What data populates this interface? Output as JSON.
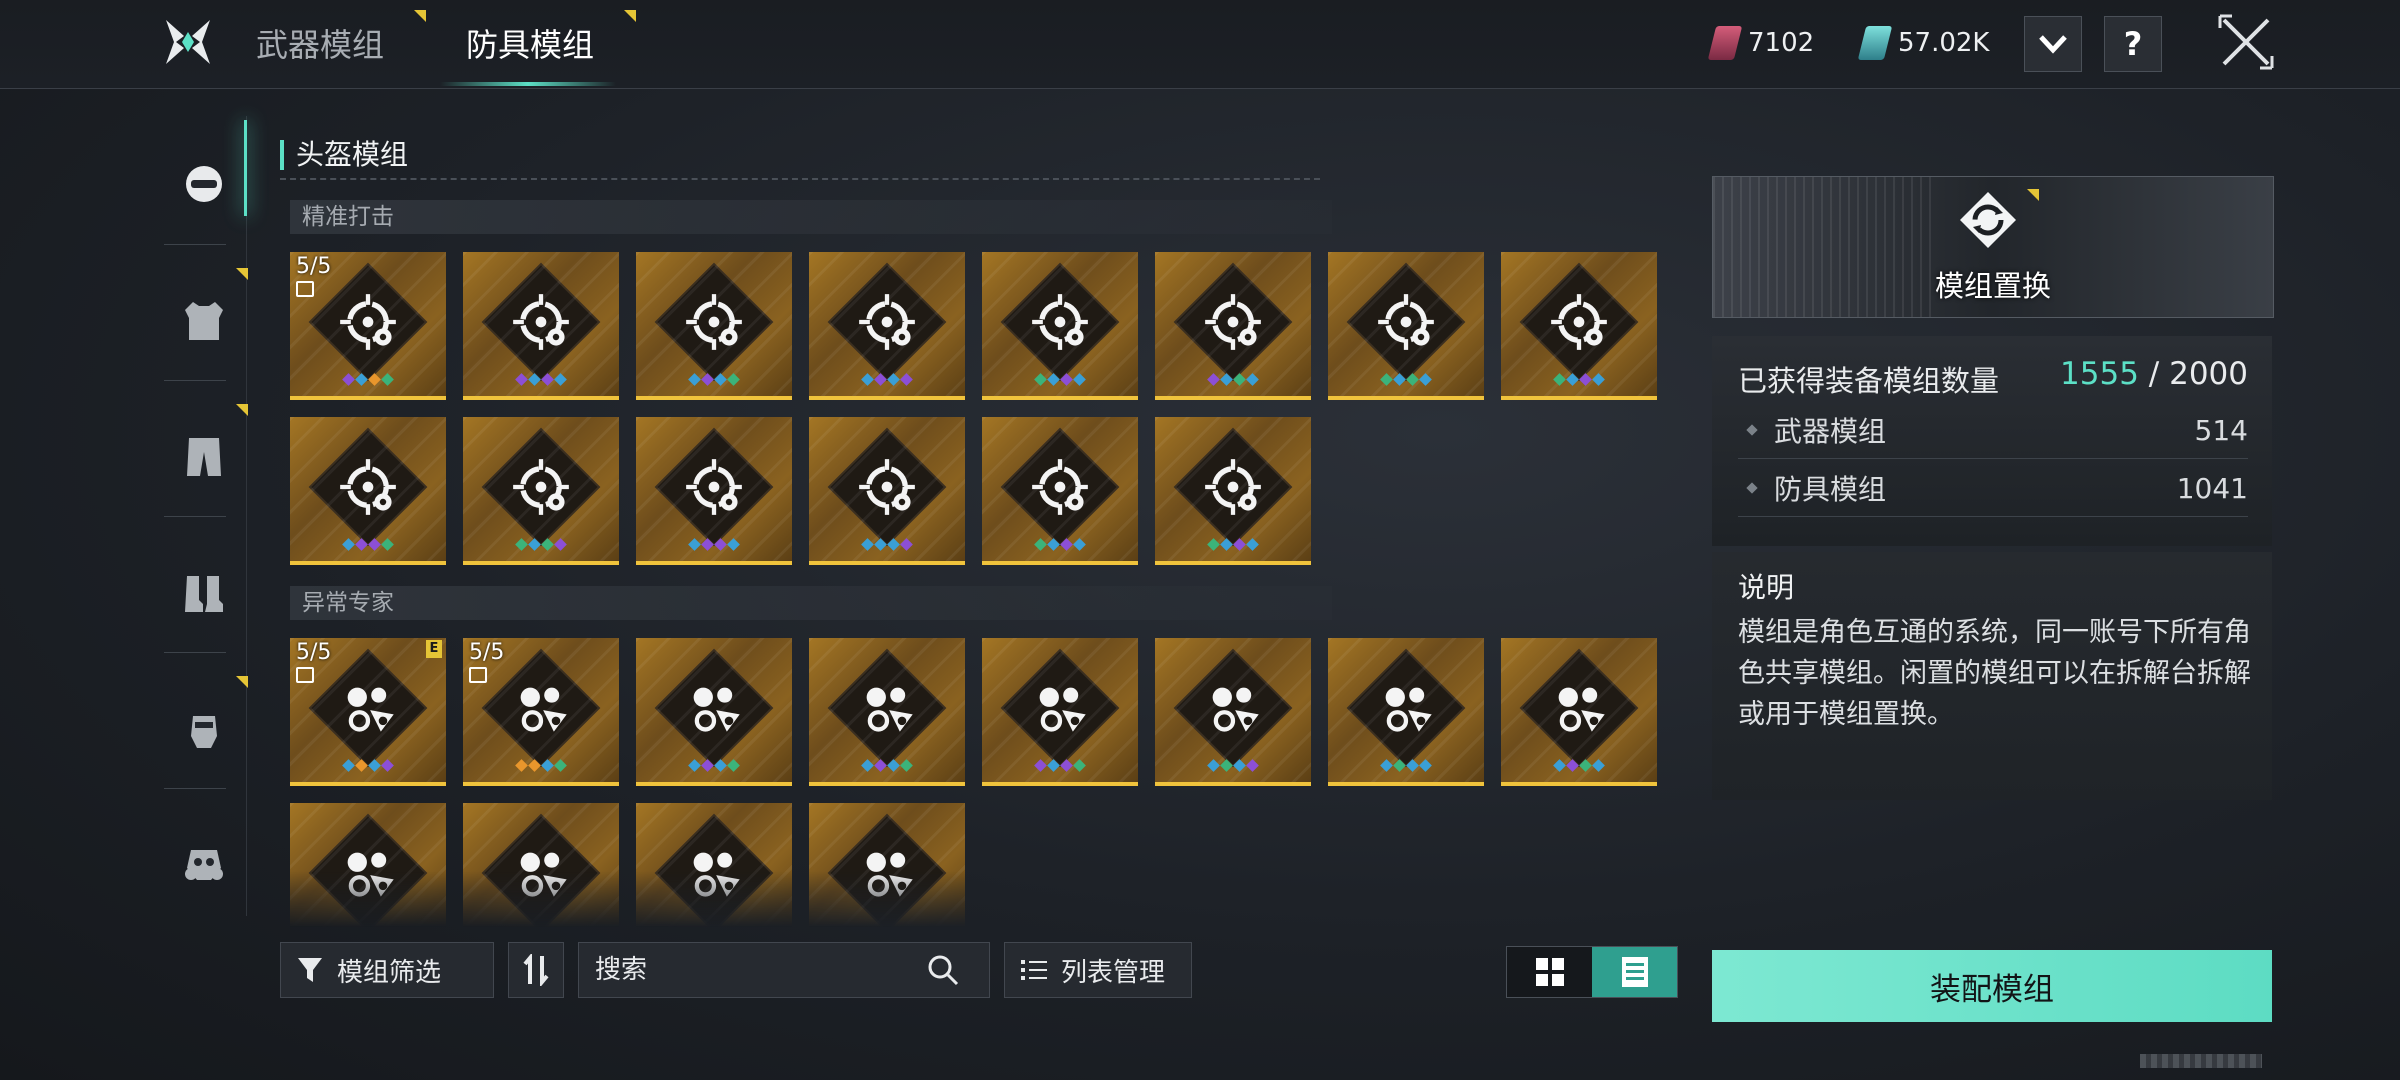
{
  "top_tabs": {
    "weapon": "武器模组",
    "armor": "防具模组"
  },
  "currency": {
    "red_amount": "7102",
    "teal_amount": "57.02K"
  },
  "help_label": "?",
  "section_title": "头盔模组",
  "groups": [
    {
      "name": "精准打击",
      "emblem": "crosshair-gear-icon"
    },
    {
      "name": "异常专家",
      "emblem": "anomaly-gear-icon"
    }
  ],
  "card_lock": {
    "count": "5/5"
  },
  "badge_e": "E",
  "gem_colors": {
    "orange": "#e8962c",
    "blue": "#3a9fd6",
    "green": "#3bb37a",
    "purple": "#8c4fd6"
  },
  "toolbar": {
    "filter": "模组筛选",
    "search_placeholder": "搜索",
    "list_manage": "列表管理"
  },
  "right_panel": {
    "replace_title": "模组置换",
    "stats_label": "已获得装备模组数量",
    "stats_current": "1555",
    "stats_sep": " / ",
    "stats_max": "2000",
    "weapon_label": "武器模组",
    "weapon_count": "514",
    "armor_label": "防具模组",
    "armor_count": "1041",
    "desc_title": "说明",
    "desc_text": "模组是角色互通的系统，同一账号下所有角色共享模组。闲置的模组可以在拆解台拆解或用于模组置换。",
    "equip_button": "装配模组"
  },
  "colors": {
    "accent": "#5ce0c6",
    "gold": "#f0c33c",
    "badge": "#e5c536"
  }
}
